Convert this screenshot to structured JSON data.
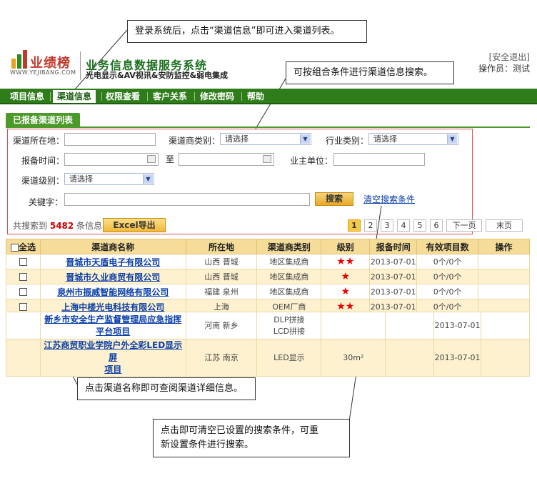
{
  "callouts": {
    "c1": "登录系统后，点击“渠道信息”即可进入渠道列表。",
    "c2": "可按组合条件进行渠道信息搜索。",
    "c3": "点击渠道名称即可查阅渠道详细信息。",
    "c4_line1": "点击即可清空已设置的搜索条件，可重",
    "c4_line2": "新设置条件进行搜索。"
  },
  "header": {
    "logo_cn": "业绩榜",
    "logo_url": "WWW.YEJIBANG.COM",
    "title": "业务信息数据服务系统",
    "subtitle": "光电显示&AV视讯&安防监控&弱电集成",
    "logout": "[安全退出]",
    "operator": "操作员：测试"
  },
  "nav": [
    "项目信息",
    "渠道信息",
    "权限查看",
    "客户关系",
    "修改密码",
    "帮助"
  ],
  "section_tab": "已报备渠道列表",
  "search": {
    "location_label": "渠道所在地：",
    "dealer_type_label": "渠道商类别：",
    "dealer_type_value": "请选择",
    "industry_label": "行业类别：",
    "industry_value": "请选择",
    "report_time_label": "报备时间：",
    "to_label": "至",
    "owner_label": "业主单位：",
    "level_label": "渠道级别：",
    "level_value": "请选择",
    "keyword_label": "关键字：",
    "search_button": "搜索",
    "clear_link": "清空搜索条件"
  },
  "results": {
    "count_prefix": "共搜索到",
    "count": "5482",
    "count_suffix": "条信息",
    "excel_button": "Excel导出"
  },
  "pager": [
    "1",
    "2",
    "3",
    "4",
    "5",
    "6",
    "下一页",
    "末页"
  ],
  "table": {
    "headers": [
      "全选",
      "渠道商名称",
      "所在地",
      "渠道商类别",
      "级别",
      "报备时间",
      "有效项目数",
      "操作"
    ],
    "rows": [
      {
        "name": "晋城市天盾电子有限公司",
        "loc": "山西  晋城",
        "type": "地区集成商",
        "stars": 2,
        "date": "2013-07-01",
        "projects": "0个/0个"
      },
      {
        "name": "晋城市久业商贸有限公司",
        "loc": "山西  晋城",
        "type": "地区集成商",
        "stars": 1,
        "date": "2013-07-01",
        "projects": "0个/0个"
      },
      {
        "name": "泉州市振威智能网络有限公司",
        "loc": "福建  泉州",
        "type": "地区集成商",
        "stars": 1,
        "date": "2013-07-01",
        "projects": "0个/0个"
      },
      {
        "name": "上海中楼光电科技有限公司",
        "loc": "上海",
        "type": "OEM厂商",
        "stars": 2,
        "date": "2013-07-01",
        "projects": "0个/0个"
      }
    ],
    "overlay_rows": [
      {
        "name1": "新乡市安全生产监督管理局应急指挥",
        "name2": "平台项目",
        "loc": "河南  新乡",
        "type1": "DLP拼接",
        "type2": "LCD拼接",
        "size": "",
        "date": "2013-07-01"
      },
      {
        "name1": "江苏商贸职业学院户外全彩LED显示屏",
        "name2": "项目",
        "loc": "江苏  南京",
        "type1": "LED显示",
        "type2": "",
        "size": "30m²",
        "date": "2013-07-01"
      }
    ]
  }
}
